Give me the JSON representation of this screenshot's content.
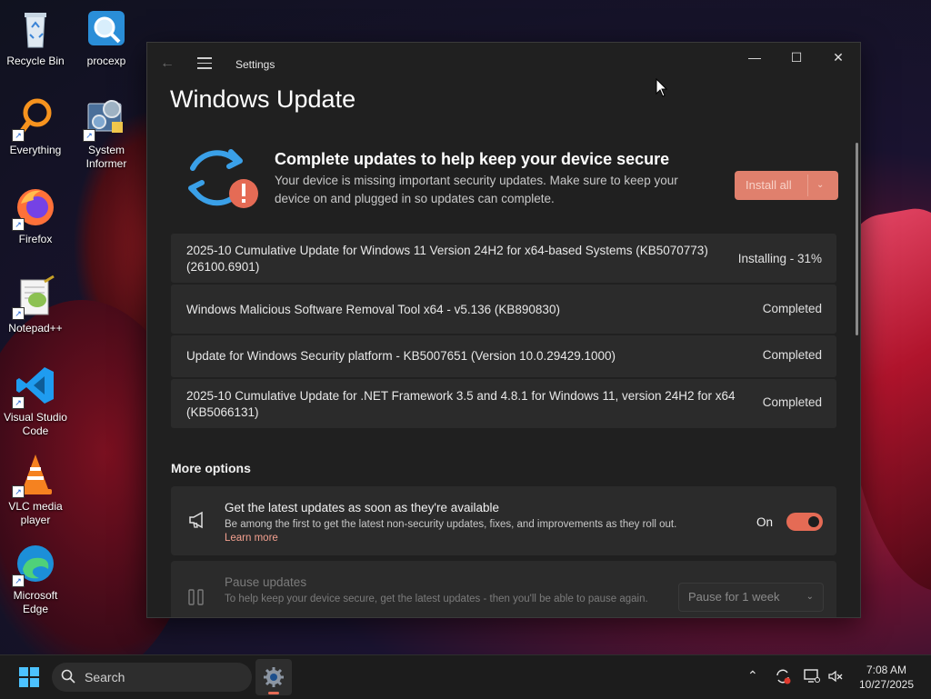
{
  "desktop": {
    "icons": [
      {
        "label": "Recycle Bin"
      },
      {
        "label": "procexp"
      },
      {
        "label": "Everything"
      },
      {
        "label": "System Informer"
      },
      {
        "label": "Firefox"
      },
      {
        "label": "Notepad++"
      },
      {
        "label": "Visual Studio Code"
      },
      {
        "label": "VLC media player"
      },
      {
        "label": "Microsoft Edge"
      }
    ]
  },
  "window": {
    "title": "Settings",
    "page_title": "Windows Update",
    "hero": {
      "heading": "Complete updates to help keep your device secure",
      "description": "Your device is missing important security updates. Make sure to keep your device on and plugged in so updates can complete.",
      "install_label": "Install all"
    },
    "updates": [
      {
        "name": "2025-10 Cumulative Update for Windows 11 Version 24H2 for x64-based Systems (KB5070773) (26100.6901)",
        "status": "Installing - 31%"
      },
      {
        "name": "Windows Malicious Software Removal Tool x64 - v5.136 (KB890830)",
        "status": "Completed"
      },
      {
        "name": "Update for Windows Security platform - KB5007651 (Version 10.0.29429.1000)",
        "status": "Completed"
      },
      {
        "name": "2025-10 Cumulative Update for .NET Framework 3.5 and 4.8.1 for Windows 11, version 24H2 for x64 (KB5066131)",
        "status": "Completed"
      }
    ],
    "more_options": {
      "heading": "More options",
      "latest_updates": {
        "title": "Get the latest updates as soon as they're available",
        "description": "Be among the first to get the latest non-security updates, fixes, and improvements as they roll out.",
        "link": "Learn more",
        "toggle_label": "On",
        "toggle_on": true
      },
      "pause_updates": {
        "title": "Pause updates",
        "description": "To help keep your device secure, get the latest updates - then you'll be able to pause again.",
        "select_value": "Pause for 1 week"
      }
    },
    "accent_color": "#e56b55"
  },
  "taskbar": {
    "search_placeholder": "Search",
    "time": "7:08 AM",
    "date": "10/27/2025"
  }
}
